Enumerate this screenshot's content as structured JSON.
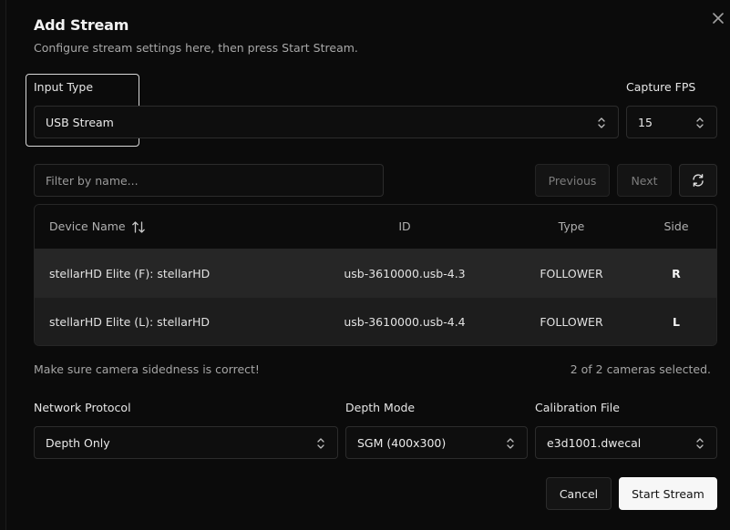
{
  "dialog": {
    "title": "Add Stream",
    "subtitle": "Configure stream settings here, then press Start Stream."
  },
  "input_type": {
    "label": "Input Type",
    "value": "USB Stream"
  },
  "capture_fps": {
    "label": "Capture FPS",
    "value": "15"
  },
  "search": {
    "placeholder": "Filter by name..."
  },
  "pagination": {
    "previous_label": "Previous",
    "next_label": "Next"
  },
  "table": {
    "columns": [
      "Device Name",
      "ID",
      "Type",
      "Side"
    ],
    "rows": [
      {
        "name": "stellarHD Elite (F): stellarHD",
        "id": "usb-3610000.usb-4.3",
        "type": "FOLLOWER",
        "side": "R"
      },
      {
        "name": "stellarHD Elite (L): stellarHD",
        "id": "usb-3610000.usb-4.4",
        "type": "FOLLOWER",
        "side": "L"
      }
    ]
  },
  "status": {
    "note": "Make sure camera sidedness is correct!",
    "selection": "2 of 2 cameras selected."
  },
  "network_protocol": {
    "label": "Network Protocol",
    "value": "Depth Only"
  },
  "depth_mode": {
    "label": "Depth Mode",
    "value": "SGM (400x300)"
  },
  "calibration_file": {
    "label": "Calibration File",
    "value": "e3d1001.dwecal"
  },
  "actions": {
    "cancel_label": "Cancel",
    "start_label": "Start Stream"
  },
  "icons": {
    "close": "close-icon",
    "chevron": "chevron-up-down-icon",
    "sort": "sort-icon",
    "refresh": "refresh-icon"
  },
  "colors": {
    "background": "#0b0b0b",
    "row_highlight": "#262626",
    "primary_button": "#f7f7f7"
  }
}
